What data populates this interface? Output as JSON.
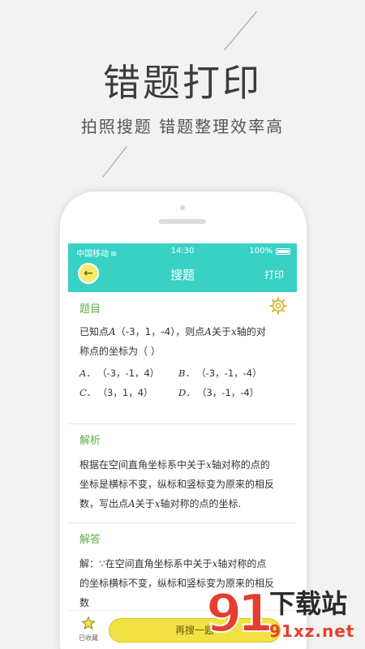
{
  "promo": {
    "headline": "错题打印",
    "subline": "拍照搜题  错题整理效率高"
  },
  "status_bar": {
    "carrier": "中国移动",
    "time": "14:30",
    "battery": "100%"
  },
  "nav": {
    "title": "搜题",
    "print_label": "打印",
    "back_icon": "back-arrow-icon"
  },
  "question": {
    "section_label": "题目",
    "stem_line1_pre": "已知点",
    "point": "A",
    "coords": "（-3，1，-4）",
    "stem_line1_mid": "，则点",
    "point2": "A",
    "stem_line1_mid2": "关于",
    "axis": "x",
    "stem_line1_post": "轴的对",
    "stem_line2": "称点的坐标为（      ）",
    "options": [
      {
        "letter": "A．",
        "value": "（-3，-1，4）"
      },
      {
        "letter": "B．",
        "value": "（-3，-1，-4）"
      },
      {
        "letter": "C．",
        "value": "（3，1，4）"
      },
      {
        "letter": "D．",
        "value": "（3，-1，-4）"
      }
    ]
  },
  "analysis": {
    "section_label": "解析",
    "line1_pre": "根据在空间直角坐标系中关于",
    "line1_axis": "x",
    "line1_post": "轴对称的点的",
    "line2": "坐标是横标不变，纵标和竖标变为原来的相反",
    "line3_pre": "数，写出点",
    "line3_point": "A",
    "line3_mid": "关于",
    "line3_axis": "x",
    "line3_post": "轴对称的点的坐标."
  },
  "answer": {
    "section_label": "解答",
    "line1_pre": "解：∵在空间直角坐标系中关于",
    "line1_axis": "x",
    "line1_post": "轴对称的点",
    "line2": "的坐标横标不变，纵标和竖标变为原来的相反",
    "line3": "数"
  },
  "bottom_bar": {
    "favorite_label": "已收藏",
    "search_again_label": "再搜一题"
  },
  "watermark": {
    "number": "91",
    "title": "下载站",
    "url": "91xz.net"
  },
  "colors": {
    "accent": "#38d1c4",
    "section_green": "#5fb14a",
    "button_yellow": "#f2e142",
    "watermark_red": "#e63e2e"
  }
}
